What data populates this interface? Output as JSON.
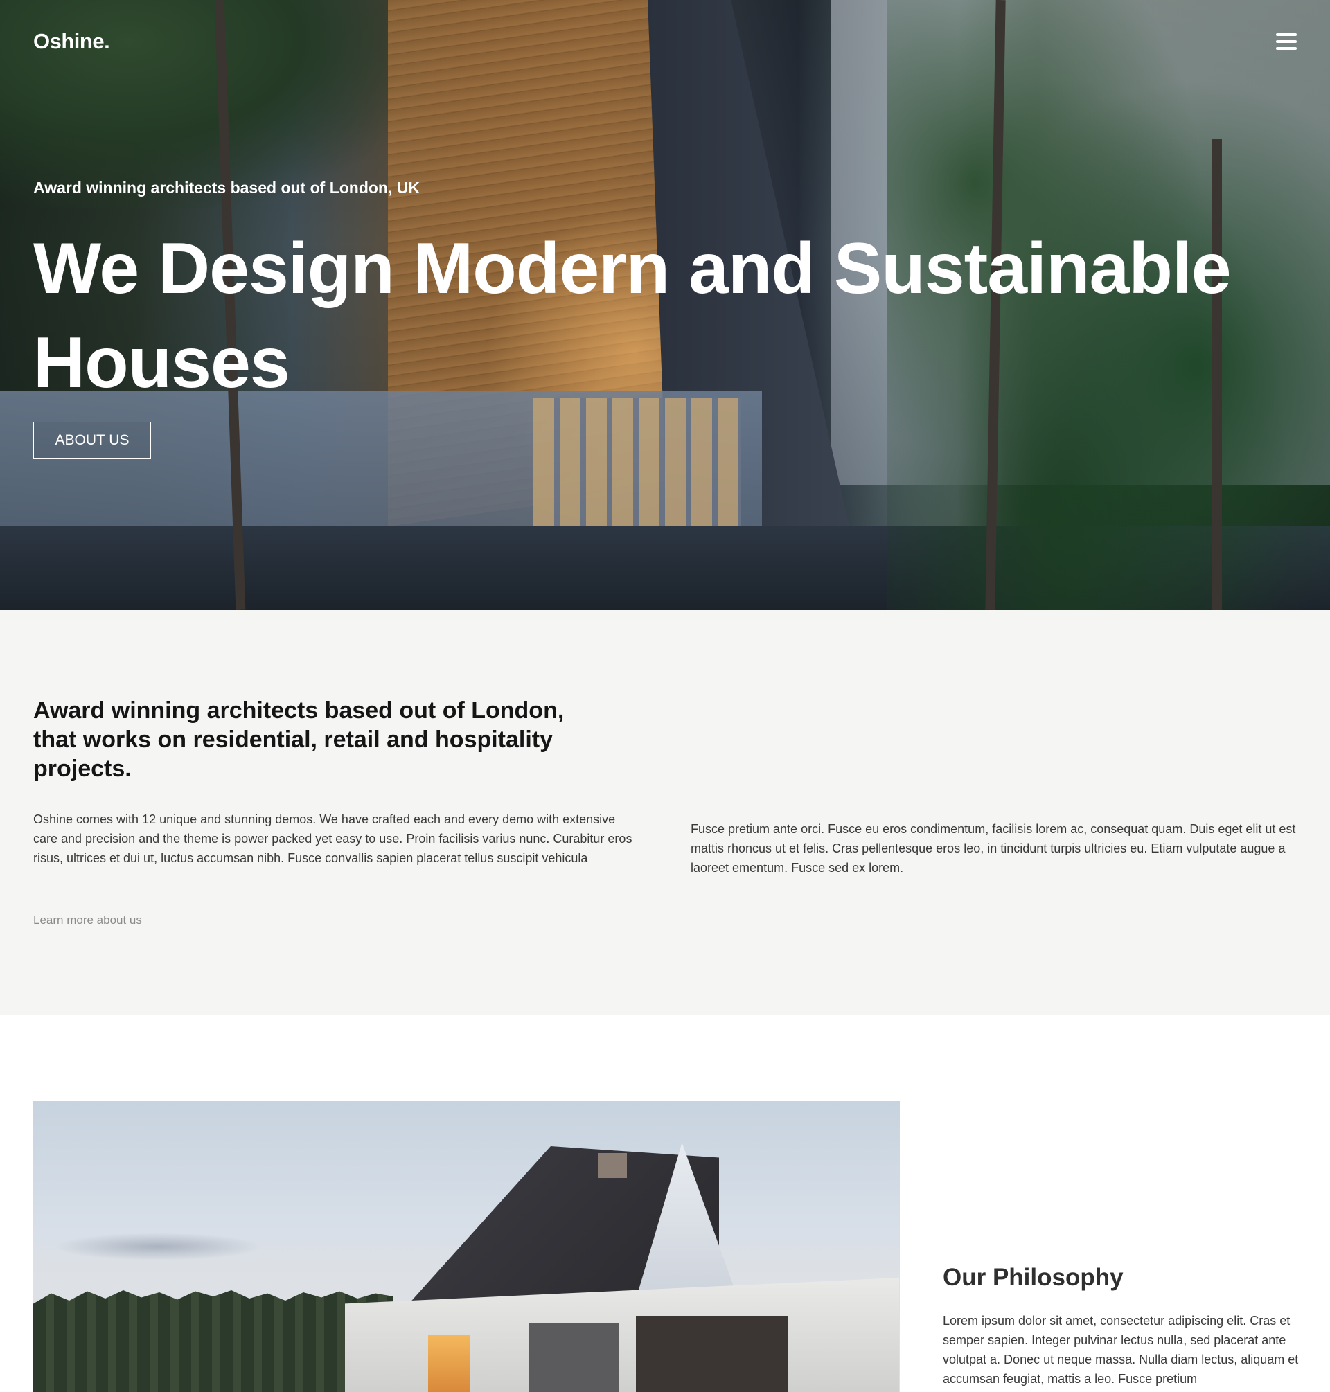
{
  "header": {
    "logo": "Oshine.",
    "menu_icon": "hamburger-menu-icon"
  },
  "hero": {
    "subtitle": "Award winning architects based out of London, UK",
    "title": "We Design Modern and Sustainable Houses",
    "button_label": "ABOUT US"
  },
  "intro": {
    "heading": "Award winning architects based out of London, that works on residential, retail and hospitality projects.",
    "col1_text": "Oshine comes with 12 unique and stunning demos. We have crafted each and every demo with extensive care and precision and the theme is power packed yet easy to use. Proin facilisis varius nunc. Curabitur eros risus, ultrices et dui ut, luctus accumsan nibh. Fusce convallis sapien placerat tellus suscipit vehicula",
    "col2_text": "Fusce pretium ante orci. Fusce eu eros condimentum, facilisis lorem ac, consequat quam. Duis eget elit ut est mattis rhoncus ut et felis. Cras pellentesque eros leo, in tincidunt turpis ultricies eu. Etiam vulputate augue a laoreet ementum. Fusce sed ex lorem.",
    "link_label": "Learn more about us"
  },
  "philosophy": {
    "title": "Our Philosophy",
    "text": "Lorem ipsum dolor sit amet, consectetur adipiscing elit. Cras et semper sapien. Integer pulvinar lectus nulla, sed placerat ante volutpat a. Donec ut neque massa. Nulla diam lectus, aliquam et accumsan feugiat, mattis a leo. Fusce pretium"
  },
  "colors": {
    "intro_background": "#f5f5f3",
    "heading_text": "#151515",
    "body_text": "#3a3a3a",
    "link_text": "#8a8a8a"
  }
}
